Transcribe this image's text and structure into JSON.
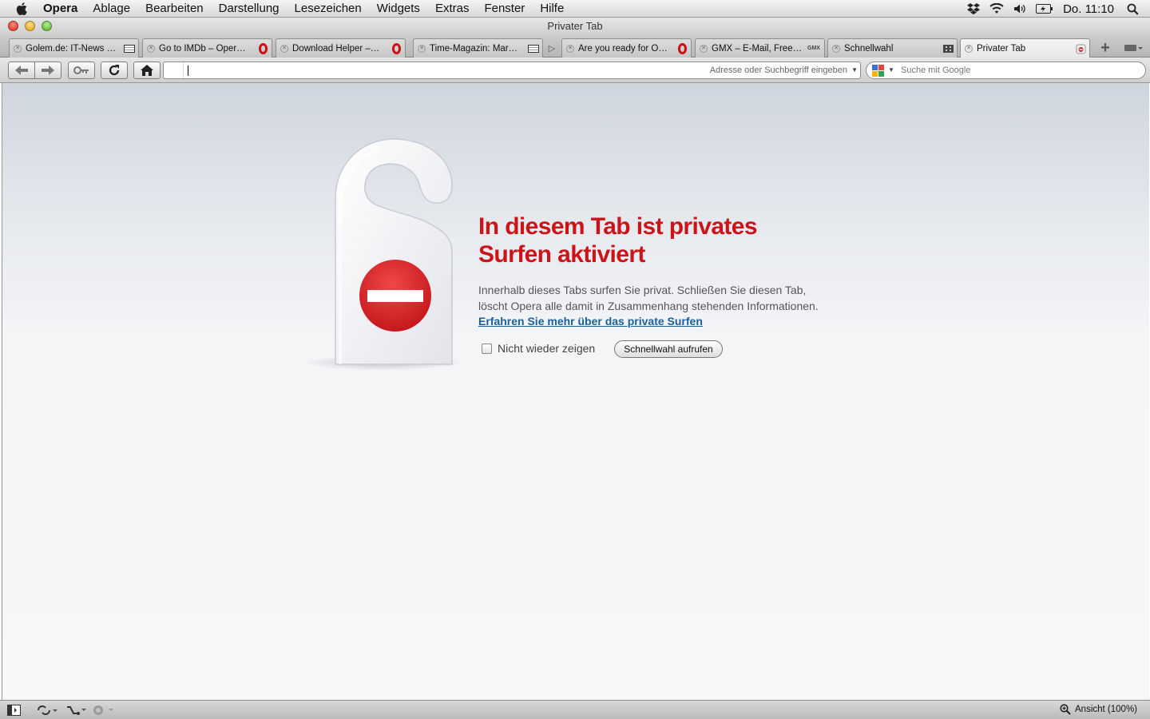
{
  "menubar": {
    "app_name": "Opera",
    "items": [
      "Ablage",
      "Bearbeiten",
      "Darstellung",
      "Lesezeichen",
      "Widgets",
      "Extras",
      "Fenster",
      "Hilfe"
    ],
    "clock": "Do. 11:10",
    "status_icons": [
      "dropbox-icon",
      "wifi-icon",
      "volume-icon",
      "battery-icon",
      "spotlight-icon"
    ]
  },
  "window": {
    "title": "Privater Tab"
  },
  "tabs": [
    {
      "label": "Golem.de: IT-News …",
      "favicon": "flag-icon"
    },
    {
      "label": "Go to IMDb – Oper…",
      "favicon": "opera-icon"
    },
    {
      "label": "Download Helper –…",
      "favicon": "opera-icon"
    },
    {
      "label": "Time-Magazin: Mar…",
      "favicon": "flag-icon"
    },
    {
      "label": "Are you ready for O…",
      "favicon": "opera-icon"
    },
    {
      "label": "GMX – E-Mail, Free…",
      "favicon": "gmx-icon",
      "favicon_text": "GMX"
    },
    {
      "label": "Schnellwahl",
      "favicon": "speed-dial-grid-icon"
    },
    {
      "label": "Privater Tab",
      "favicon": "private-icon",
      "active": true
    }
  ],
  "toolbar": {
    "buttons": [
      "back-icon",
      "forward-icon",
      "key-icon",
      "reload-icon",
      "home-icon"
    ],
    "address_placeholder": "Adresse oder Suchbegriff eingeben",
    "address_value": "",
    "search_placeholder": "Suche mit Google",
    "search_engine": "Google"
  },
  "page": {
    "headline": "In diesem Tab ist privates Surfen aktiviert",
    "description": "Innerhalb dieses Tabs surfen Sie privat. Schließen Sie diesen Tab, löscht Opera alle damit in Zusammenhang stehenden Informationen.",
    "learn_more_link": "Erfahren Sie mehr über das private Surfen",
    "checkbox_label": "Nicht wieder zeigen",
    "checkbox_checked": false,
    "speed_dial_button": "Schnellwahl aufrufen",
    "accent_color": "#cc1418",
    "link_color": "#1a5f9e"
  },
  "statusbar": {
    "zoom_label": "Ansicht (100%)"
  }
}
